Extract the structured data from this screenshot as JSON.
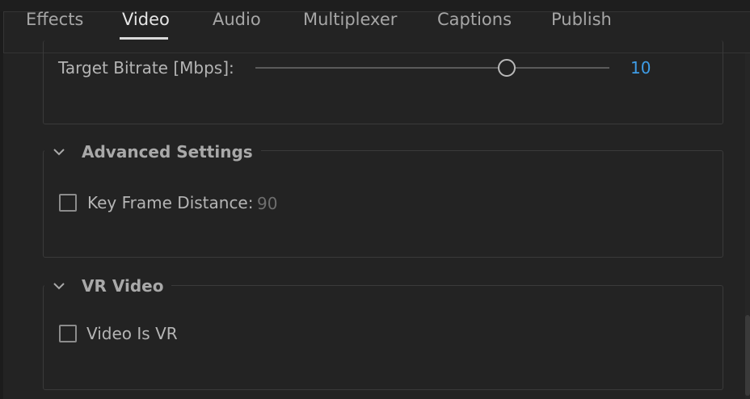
{
  "tabs": [
    {
      "label": "Effects",
      "active": false
    },
    {
      "label": "Video",
      "active": true
    },
    {
      "label": "Audio",
      "active": false
    },
    {
      "label": "Multiplexer",
      "active": false
    },
    {
      "label": "Captions",
      "active": false
    },
    {
      "label": "Publish",
      "active": false
    }
  ],
  "bitrate": {
    "label": "Target Bitrate [Mbps]:",
    "value": "10",
    "slider_fraction": 0.71
  },
  "advanced_settings": {
    "title": "Advanced Settings",
    "key_frame_label": "Key Frame Distance:",
    "key_frame_value": "90",
    "key_frame_checked": false
  },
  "vr_video": {
    "title": "VR Video",
    "video_is_vr_label": "Video Is VR",
    "video_is_vr_checked": false
  },
  "colors": {
    "background": "#232323",
    "accent_value": "#3e9ce6",
    "text": "#b8b8b8"
  },
  "icons": {
    "collapse": "chevron-down-icon"
  }
}
